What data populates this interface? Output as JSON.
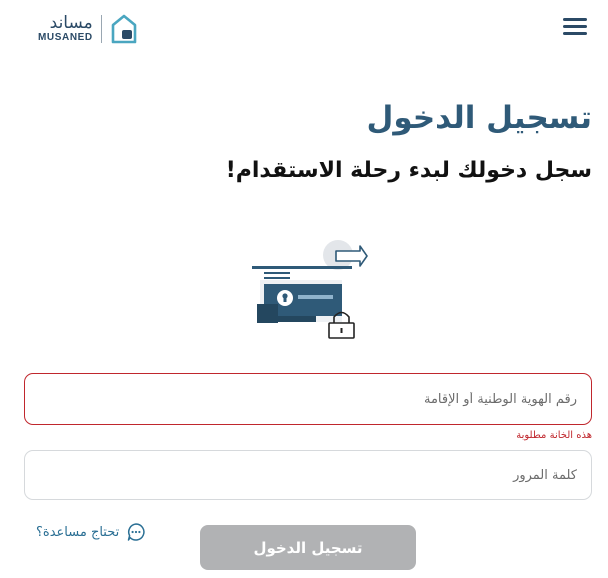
{
  "header": {
    "logo_ar": "مساند",
    "logo_en": "MUSANED",
    "menu_icon": "hamburger-menu-icon"
  },
  "login": {
    "title": "تسجيل الدخول",
    "subtitle": "سجل دخولك لبدء رحلة الاستقدام!",
    "illustration_icon": "secure-login-illustration",
    "id_field": {
      "placeholder": "رقم الهوية الوطنية أو الإقامة",
      "value": "",
      "error": "هذه الخانة مطلوبة"
    },
    "password_field": {
      "placeholder": "كلمة المرور",
      "value": ""
    },
    "help_label": "تحتاج مساعدة؟",
    "help_icon": "chat-bubble-icon",
    "submit_label": "تسجيل الدخول",
    "submit_disabled": true
  },
  "colors": {
    "brand": "#2f5a78",
    "error": "#c0272d",
    "link": "#2a6f94",
    "button_disabled": "#b1b2b4"
  }
}
